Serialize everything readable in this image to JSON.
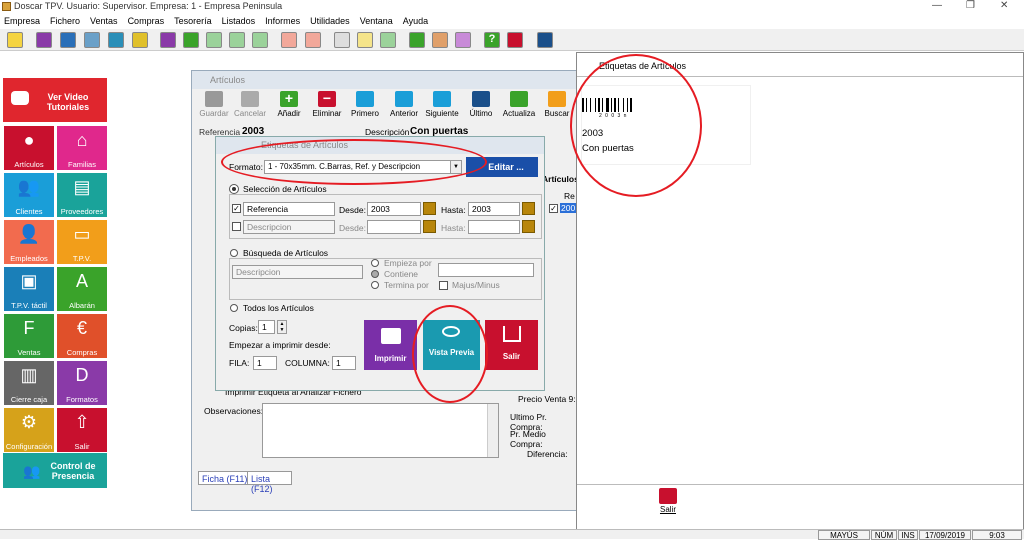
{
  "window": {
    "title": "Doscar TPV. Usuario: Supervisor. Empresa: 1 - Empresa Peninsula"
  },
  "menu": [
    "Empresa",
    "Fichero",
    "Ventas",
    "Compras",
    "Tesorería",
    "Listados",
    "Informes",
    "Utilidades",
    "Ventana",
    "Ayuda"
  ],
  "sidebar": {
    "tutorials": "Ver Video Tutoriales",
    "items": [
      {
        "label": "Artículos",
        "color": "#c8102e"
      },
      {
        "label": "Familias",
        "color": "#e0288c"
      },
      {
        "label": "Clientes",
        "color": "#1a9ed8"
      },
      {
        "label": "Proveedores",
        "color": "#1aa39a"
      },
      {
        "label": "Empleados",
        "color": "#f26b4e"
      },
      {
        "label": "T.P.V.",
        "color": "#f29e1a"
      },
      {
        "label": "T.P.V. táctil",
        "color": "#1a7fb8"
      },
      {
        "label": "Albarán",
        "color": "#3aa32a"
      },
      {
        "label": "Ventas",
        "color": "#2e9b38"
      },
      {
        "label": "Compras",
        "color": "#e0502a"
      },
      {
        "label": "Cierre caja",
        "color": "#666666"
      },
      {
        "label": "Formatos",
        "color": "#8a3aa8"
      },
      {
        "label": "Configuración",
        "color": "#d6a21a"
      },
      {
        "label": "Salir",
        "color": "#c8102e"
      }
    ],
    "presence": "Control de Presencia"
  },
  "articles_window": {
    "title": "Artículos",
    "toolbar": [
      "Guardar",
      "Cancelar",
      "Añadir",
      "Eliminar",
      "Primero",
      "Anterior",
      "Siguiente",
      "Último",
      "Actualiza",
      "Buscar"
    ],
    "referencia_label": "Referencia",
    "referencia_value": "2003",
    "descripcion_label": "Descripción",
    "descripcion_value": "Con puertas",
    "observaciones_label": "Observaciones:",
    "precio_venta": "Precio Venta 9:",
    "ultimo_pr_compra": "Ultimo Pr. Compra:",
    "pr_medio_compra": "Pr. Medio Compra:",
    "diferencia": "Diferencia:",
    "tab_ficha": "Ficha (F11)",
    "tab_lista": "Lista (F12)",
    "imprimir_analiza": "Imprimir Etiqueta al Analizar Fichero",
    "articulos_label": "Artículos",
    "ref_col": "Re",
    "list_value": "200"
  },
  "etiquetas_dialog": {
    "title": "Etiquetas de Artículos",
    "formato_label": "Formato:",
    "formato_value": "1 - 70x35mm. C.Barras, Ref. y Descripcion",
    "editar": "Editar ...",
    "seleccion": "Selección de Artículos",
    "referencia": "Referencia",
    "descripcion": "Descripcion",
    "desde": "Desde:",
    "hasta": "Hasta:",
    "desde_value": "2003",
    "hasta_value": "2003",
    "busqueda": "Búsqueda de Artículos",
    "busqueda_field": "Descripcion",
    "empieza": "Empieza por",
    "contiene": "Contiene",
    "termina": "Termina por",
    "mayus": "Majus/Minus",
    "todos": "Todos los Artículos",
    "copias_label": "Copias:",
    "copias_value": "1",
    "empezar": "Empezar a imprimir desde:",
    "fila_label": "FILA:",
    "fila_value": "1",
    "columna_label": "COLUMNA:",
    "columna_value": "1",
    "imprimir": "Imprimir",
    "vista_previa": "Vista Previa",
    "salir": "Salir"
  },
  "preview": {
    "title": "Etiquetas de Artículos",
    "barcode_text": "2 0 0 3 n",
    "ref": "2003",
    "desc": "Con puertas",
    "salir": "Salir"
  },
  "status": {
    "mayus": "MAYÚS",
    "num": "NÚM",
    "ins": "INS",
    "date": "17/09/2019",
    "time": "9:03"
  }
}
